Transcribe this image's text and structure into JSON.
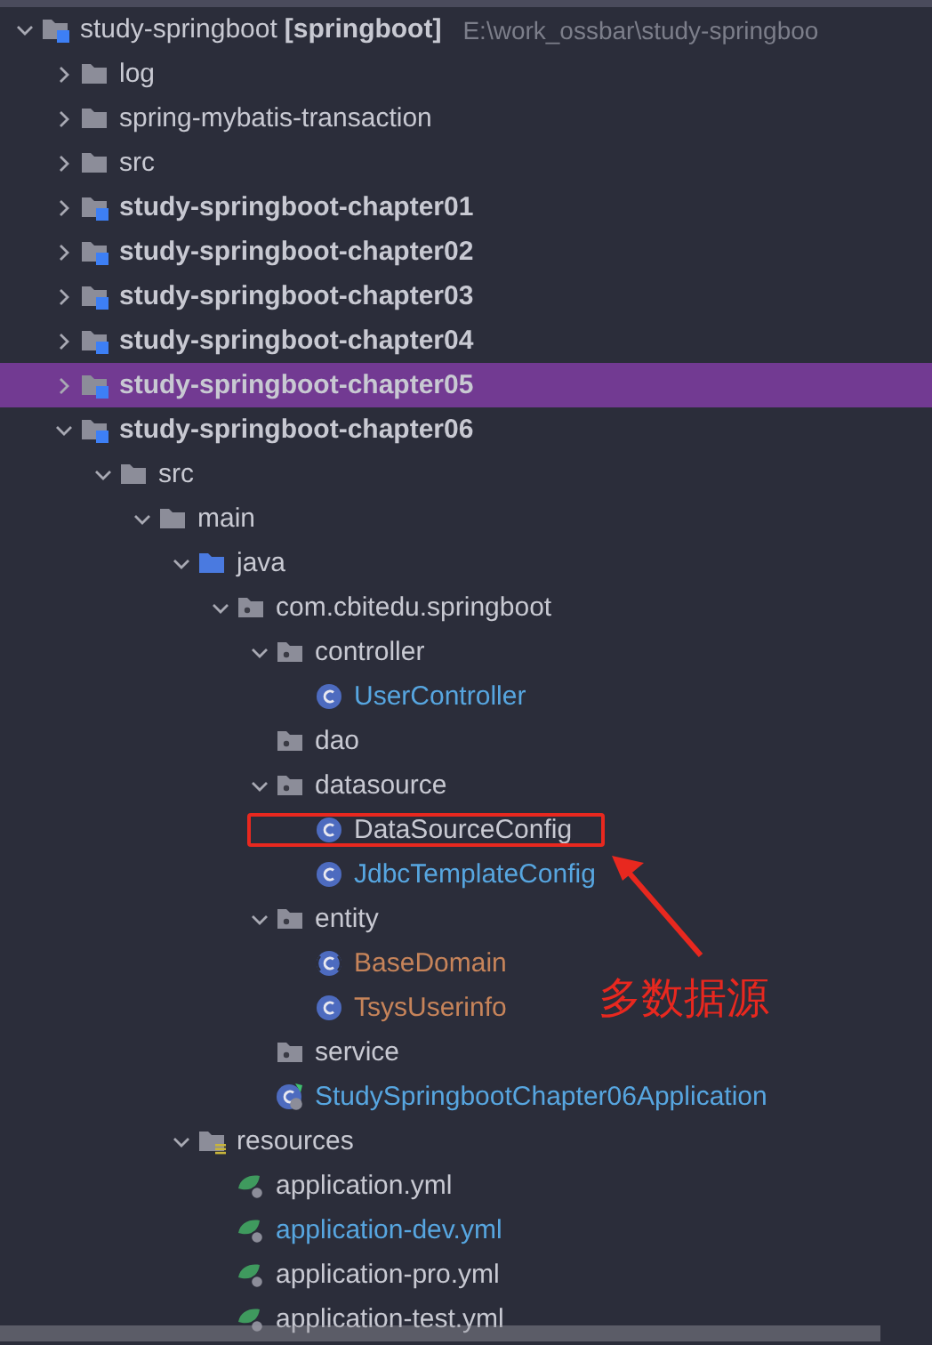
{
  "tree": {
    "root": {
      "name": "study-springboot",
      "module_tag": "[springboot]",
      "path": "E:\\work_ossbar\\study-springboo",
      "kind": "module",
      "expanded": true,
      "selected": false,
      "children": [
        {
          "name": "log",
          "kind": "folder",
          "expanded": false,
          "selected": false
        },
        {
          "name": "spring-mybatis-transaction",
          "kind": "folder",
          "expanded": false,
          "selected": false
        },
        {
          "name": "src",
          "kind": "folder",
          "expanded": false,
          "selected": false
        },
        {
          "name": "study-springboot-chapter01",
          "kind": "module",
          "expanded": false,
          "selected": false
        },
        {
          "name": "study-springboot-chapter02",
          "kind": "module",
          "expanded": false,
          "selected": false
        },
        {
          "name": "study-springboot-chapter03",
          "kind": "module",
          "expanded": false,
          "selected": false
        },
        {
          "name": "study-springboot-chapter04",
          "kind": "module",
          "expanded": false,
          "selected": false
        },
        {
          "name": "study-springboot-chapter05",
          "kind": "module",
          "expanded": false,
          "selected": true
        },
        {
          "name": "study-springboot-chapter06",
          "kind": "module",
          "expanded": true,
          "selected": false,
          "children": [
            {
              "name": "src",
              "kind": "folder",
              "expanded": true,
              "selected": false,
              "children": [
                {
                  "name": "main",
                  "kind": "folder",
                  "expanded": true,
                  "selected": false,
                  "children": [
                    {
                      "name": "java",
                      "kind": "source",
                      "expanded": true,
                      "selected": false,
                      "children": [
                        {
                          "name": "com.cbitedu.springboot",
                          "kind": "package",
                          "expanded": true,
                          "selected": false,
                          "children": [
                            {
                              "name": "controller",
                              "kind": "package",
                              "expanded": true,
                              "selected": false,
                              "children": [
                                {
                                  "name": "UserController",
                                  "kind": "class",
                                  "color": "#57a6e0",
                                  "selected": false
                                }
                              ]
                            },
                            {
                              "name": "dao",
                              "kind": "package",
                              "selected": false
                            },
                            {
                              "name": "datasource",
                              "kind": "package",
                              "expanded": true,
                              "selected": false,
                              "children": [
                                {
                                  "name": "DataSourceConfig",
                                  "kind": "class",
                                  "selected": false,
                                  "boxed": true
                                },
                                {
                                  "name": "JdbcTemplateConfig",
                                  "kind": "class",
                                  "color": "#57a6e0",
                                  "selected": false
                                }
                              ]
                            },
                            {
                              "name": "entity",
                              "kind": "package",
                              "expanded": true,
                              "selected": false,
                              "children": [
                                {
                                  "name": "BaseDomain",
                                  "kind": "abstract",
                                  "color": "#c7845a",
                                  "selected": false
                                },
                                {
                                  "name": "TsysUserinfo",
                                  "kind": "class",
                                  "color": "#c7845a",
                                  "selected": false
                                }
                              ]
                            },
                            {
                              "name": "service",
                              "kind": "package",
                              "selected": false
                            },
                            {
                              "name": "StudySpringbootChapter06Application",
                              "kind": "app",
                              "color": "#57a6e0",
                              "selected": false
                            }
                          ]
                        }
                      ]
                    },
                    {
                      "name": "resources",
                      "kind": "resources",
                      "expanded": true,
                      "selected": false,
                      "children": [
                        {
                          "name": "application.yml",
                          "kind": "yaml",
                          "selected": false
                        },
                        {
                          "name": "application-dev.yml",
                          "kind": "yaml",
                          "color": "#57a6e0",
                          "selected": false
                        },
                        {
                          "name": "application-pro.yml",
                          "kind": "yaml",
                          "selected": false
                        },
                        {
                          "name": "application-test.yml",
                          "kind": "yaml",
                          "selected": false
                        }
                      ]
                    }
                  ]
                }
              ]
            }
          ]
        }
      ]
    }
  },
  "annotation": {
    "label": "多数据源"
  }
}
